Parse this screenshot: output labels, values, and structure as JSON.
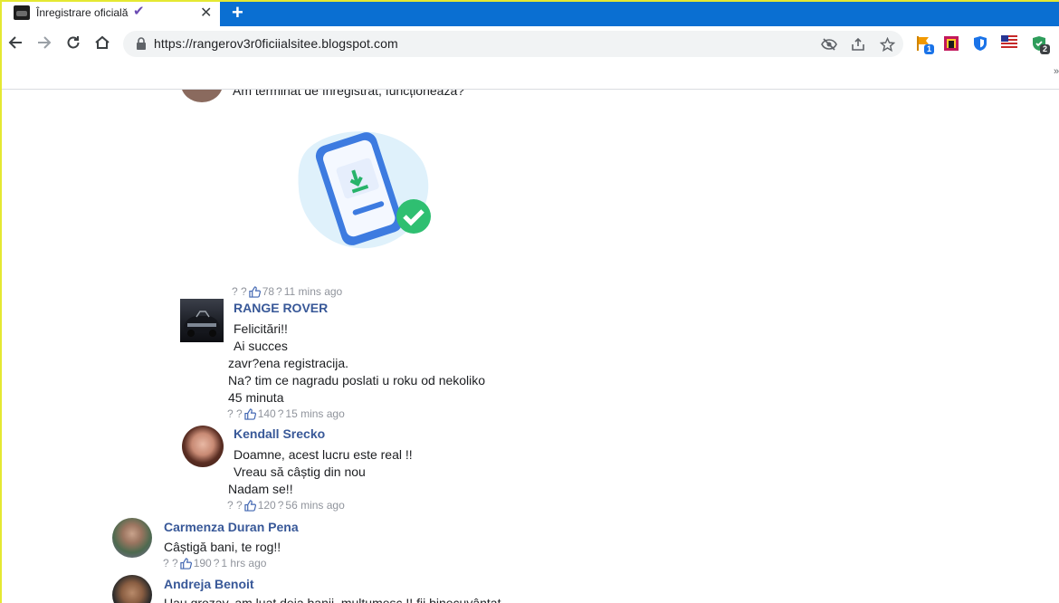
{
  "browser": {
    "tab_title": "Înregistrare oficială",
    "tab_check_icon": "checkmark-icon",
    "url": "https://rangerov3r0ficiialsitee.blogspot.com",
    "accent_color": "#0a6fd2",
    "extensions": [
      {
        "name": "flag-extension-icon",
        "badge": "1"
      },
      {
        "name": "colorful-extension-icon",
        "badge": ""
      },
      {
        "name": "shield-extension-icon",
        "badge": ""
      },
      {
        "name": "us-flag-extension-icon",
        "badge": ""
      },
      {
        "name": "green-shield-extension-icon",
        "badge": "2"
      }
    ]
  },
  "comments": [
    {
      "id": "c0",
      "name": "",
      "lines": [
        "Am terminat de înregistrat, funcționează?"
      ],
      "has_image": true,
      "meta": {
        "prefix": "? ?",
        "likes": "78",
        "sep": "?",
        "time": "11 mins ago"
      }
    },
    {
      "id": "c1",
      "name": "RANGE ROVER",
      "lines": [
        "Felicitări!!",
        "Ai succes",
        "zavr?ena registracija.",
        "Na? tim ce nagradu poslati u roku od nekoliko",
        "45 minuta"
      ],
      "meta": {
        "prefix": "? ?",
        "likes": "140",
        "sep": "?",
        "time": "15 mins ago"
      }
    },
    {
      "id": "c2",
      "name": "Kendall Srecko",
      "lines": [
        "Doamne, acest lucru este real !!",
        "Vreau să câștig din nou",
        "Nadam se!!"
      ],
      "meta": {
        "prefix": "? ?",
        "likes": "120",
        "sep": "?",
        "time": "56 mins ago"
      }
    },
    {
      "id": "c3",
      "name": "Carmenza Duran Pena",
      "lines": [
        "Câștigă bani, te rog!!"
      ],
      "meta": {
        "prefix": "? ?",
        "likes": "190",
        "sep": "?",
        "time": "1 hrs ago"
      }
    },
    {
      "id": "c4",
      "name": "Andreja Benoit",
      "lines": [
        "Uau grozav, am luat deja banii, mulțumesc !! fii binecuvântat"
      ],
      "meta": null
    }
  ],
  "colors": {
    "name_link": "#385898",
    "meta_gray": "#90949c",
    "like_blue": "#4267b2"
  }
}
